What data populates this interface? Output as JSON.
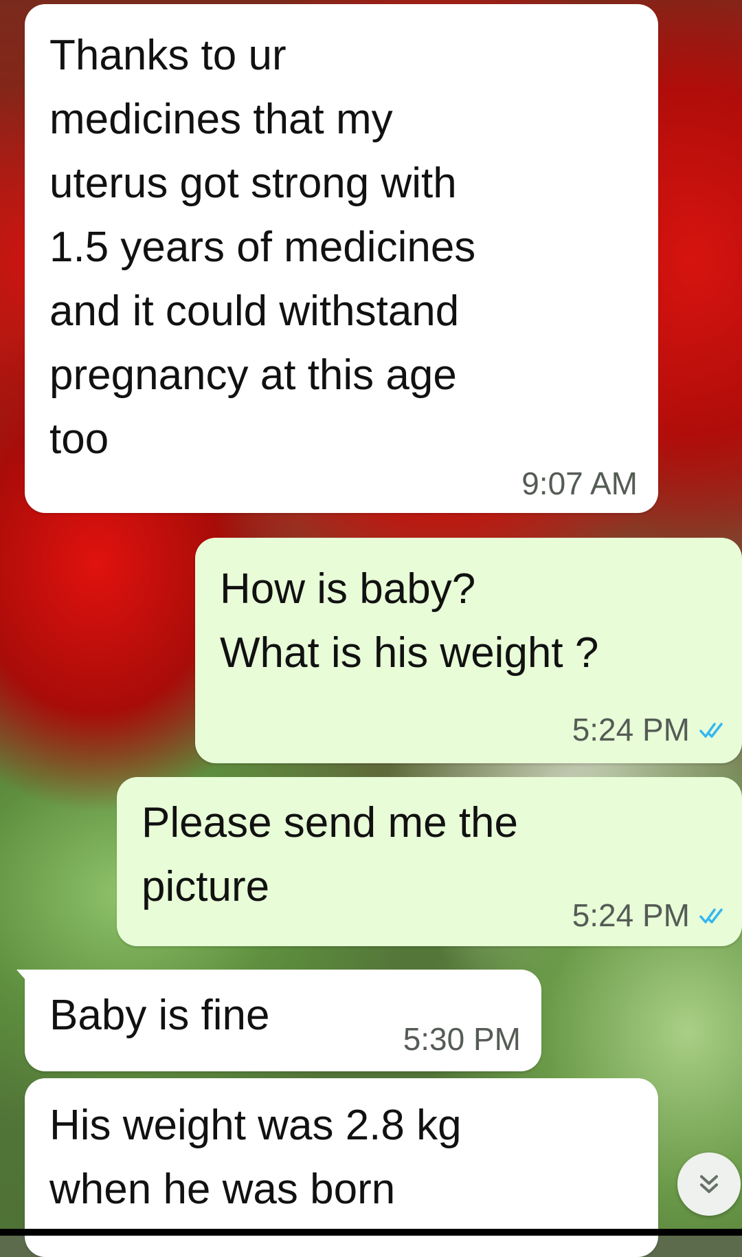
{
  "messages": [
    {
      "direction": "incoming",
      "text": "Thanks to ur\nmedicines that my\nuterus got strong with\n1.5 years of medicines\nand it could withstand\npregnancy at this age\ntoo",
      "time": "9:07 AM"
    },
    {
      "direction": "outgoing",
      "text": "How is baby?\nWhat is his weight ?",
      "time": "5:24 PM",
      "status": "read-double-check"
    },
    {
      "direction": "outgoing",
      "text": "Please send me the\npicture",
      "time": "5:24 PM",
      "status": "read-double-check"
    },
    {
      "direction": "incoming",
      "text": "Baby is fine",
      "time": "5:30 PM"
    },
    {
      "direction": "incoming",
      "text": "His weight was 2.8 kg\nwhen he was born",
      "time": ""
    }
  ],
  "scroll_button": {
    "icon": "double-chevron-down-icon"
  },
  "colors": {
    "incoming_bubble": "#ffffff",
    "outgoing_bubble": "#e7fcd7",
    "read_tick": "#34b7f1",
    "timestamp": "#555b55"
  }
}
